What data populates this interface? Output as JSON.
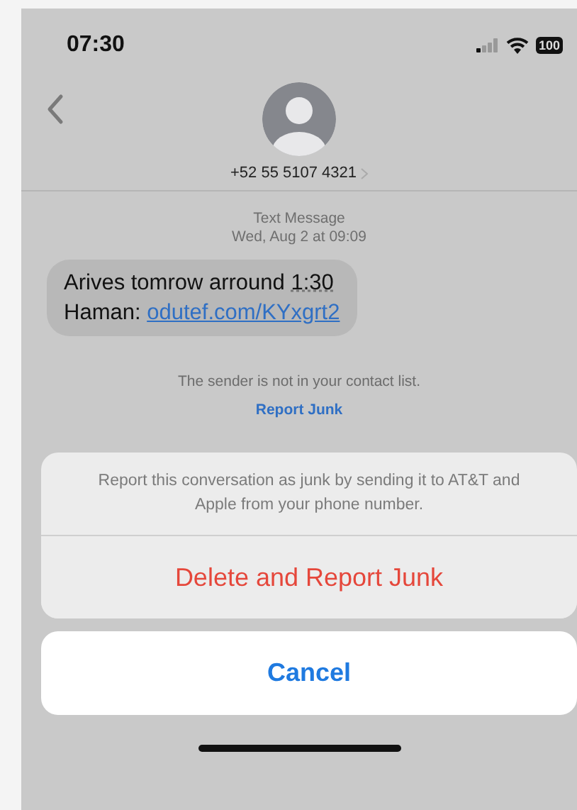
{
  "status_bar": {
    "time": "07:30",
    "battery": "100"
  },
  "header": {
    "contact": "+52 55 5107 4321"
  },
  "conversation": {
    "service": "Text Message",
    "timestamp": "Wed, Aug 2 at 09:09",
    "message": {
      "text_1": "Arives tomrow arround ",
      "time": "1:30",
      "text_2": "Haman: ",
      "link": "odutef.com/KYxgrt2"
    },
    "sender_note": "The sender is not in your contact list.",
    "report_link": "Report Junk"
  },
  "action_sheet": {
    "message": "Report this conversation as junk by sending it to AT&T and Apple from your phone number.",
    "actions": [
      {
        "label": "Delete and Report Junk",
        "kind": "destructive"
      }
    ],
    "cancel": "Cancel"
  }
}
